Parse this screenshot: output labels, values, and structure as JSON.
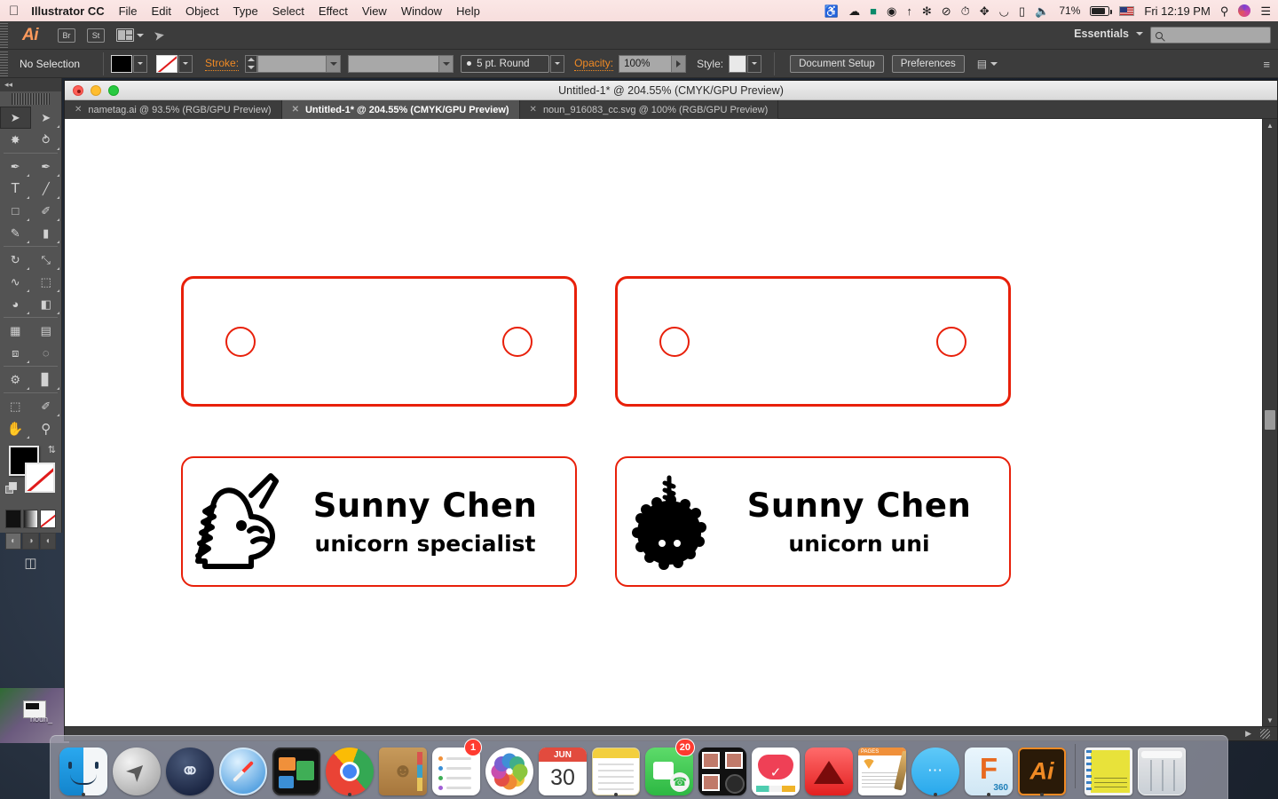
{
  "menubar": {
    "apple_icon": "apple-icon",
    "app_name": "Illustrator CC",
    "items": [
      "File",
      "Edit",
      "Object",
      "Type",
      "Select",
      "Effect",
      "View",
      "Window",
      "Help"
    ],
    "status_icons": [
      "airport-utility-icon",
      "creative-cloud-icon",
      "dropbox-icon",
      "mailbutler-icon",
      "fork-icon",
      "bug-icon",
      "do-not-disturb-icon",
      "time-machine-icon",
      "bluetooth-icon",
      "wifi-icon",
      "airplay-icon",
      "volume-icon"
    ],
    "battery_percent": "71%",
    "input_flag": "us-flag-icon",
    "clock": "Fri 12:19 PM",
    "spotlight_icon": "search-icon",
    "siri_icon": "siri-icon",
    "notification_icon": "notification-center-icon"
  },
  "app_bar": {
    "logo": "Ai",
    "bridge_label": "Br",
    "stock_label": "St",
    "arrange_icon": "arrange-documents-icon",
    "rocket_icon": "rocket-icon",
    "workspace": "Essentials",
    "search_placeholder": ""
  },
  "control_bar": {
    "selection_status": "No Selection",
    "fill_label": "fill-swatch",
    "stroke_swatch_label": "stroke-swatch",
    "stroke_label": "Stroke:",
    "stroke_weight": "",
    "stroke_variable_width": "",
    "brush_profile": "5 pt. Round",
    "opacity_label": "Opacity:",
    "opacity_value": "100%",
    "style_label": "Style:",
    "document_setup": "Document Setup",
    "preferences": "Preferences",
    "align_icon": "align-icon",
    "panel_menu_icon": "panel-menu-icon"
  },
  "tools": {
    "collapse_icon": "collapse-panel-icon",
    "items": [
      {
        "name": "selection-tool",
        "glyph": "➤",
        "selected": true
      },
      {
        "name": "direct-selection-tool",
        "glyph": "➤",
        "selected": false
      },
      {
        "name": "magic-wand-tool",
        "glyph": "✸",
        "selected": false
      },
      {
        "name": "lasso-tool",
        "glyph": "⤵",
        "selected": false
      },
      {
        "name": "pen-tool",
        "glyph": "✒",
        "selected": false
      },
      {
        "name": "curvature-tool",
        "glyph": "✒",
        "selected": false
      },
      {
        "name": "type-tool",
        "glyph": "T",
        "selected": false
      },
      {
        "name": "line-segment-tool",
        "glyph": "╱",
        "selected": false
      },
      {
        "name": "rectangle-tool",
        "glyph": "■",
        "selected": false
      },
      {
        "name": "paintbrush-tool",
        "glyph": "✎",
        "selected": false
      },
      {
        "name": "pencil-tool",
        "glyph": "✏",
        "selected": false
      },
      {
        "name": "eraser-tool",
        "glyph": "▰",
        "selected": false
      },
      {
        "name": "rotate-tool",
        "glyph": "↺",
        "selected": false
      },
      {
        "name": "scale-tool",
        "glyph": "⤡",
        "selected": false
      },
      {
        "name": "width-tool",
        "glyph": "∿",
        "selected": false
      },
      {
        "name": "free-transform-tool",
        "glyph": "⬚",
        "selected": false
      },
      {
        "name": "shape-builder-tool",
        "glyph": "◔",
        "selected": false
      },
      {
        "name": "perspective-grid-tool",
        "glyph": "◧",
        "selected": false
      },
      {
        "name": "mesh-tool",
        "glyph": "⁂",
        "selected": false
      },
      {
        "name": "gradient-tool",
        "glyph": "▤",
        "selected": false
      },
      {
        "name": "eyedropper-tool",
        "glyph": "⚗",
        "selected": false
      },
      {
        "name": "blend-tool",
        "glyph": "◎",
        "selected": false
      },
      {
        "name": "symbol-sprayer-tool",
        "glyph": "♨",
        "selected": false
      },
      {
        "name": "column-graph-tool",
        "glyph": "▫",
        "selected": false
      },
      {
        "name": "artboard-tool",
        "glyph": "⬚",
        "selected": false
      },
      {
        "name": "slice-tool",
        "glyph": "✂",
        "selected": false
      },
      {
        "name": "hand-tool",
        "glyph": "✋",
        "selected": false
      },
      {
        "name": "zoom-tool",
        "glyph": "⌕",
        "selected": false
      }
    ],
    "fill_color": "#000000",
    "stroke_color": "#ffffff",
    "swap_icon": "swap-fill-stroke-icon",
    "default_icon": "default-fill-stroke-icon",
    "color_modes": [
      "color-mode",
      "gradient-mode",
      "none-mode"
    ],
    "draw_modes": [
      "draw-normal",
      "draw-behind",
      "draw-inside"
    ],
    "screen_mode_icon": "change-screen-mode-icon"
  },
  "document_window": {
    "title": "Untitled-1* @ 204.55% (CMYK/GPU Preview)",
    "traffic_lights": [
      "close-button",
      "minimize-button",
      "zoom-button"
    ],
    "tabs": [
      {
        "label": "nametag.ai @ 93.5% (RGB/GPU Preview)",
        "active": false
      },
      {
        "label": "Untitled-1* @ 204.55% (CMYK/GPU Preview)",
        "active": true
      },
      {
        "label": "noun_916083_cc.svg @ 100% (RGB/GPU Preview)",
        "active": false
      }
    ]
  },
  "artwork": {
    "accent_color": "#e8200a",
    "nametags": [
      {
        "name": "nametag-blank-left",
        "has_art": false,
        "holes": 2
      },
      {
        "name": "nametag-blank-right",
        "has_art": false,
        "holes": 2
      },
      {
        "name": "nametag-unicorn-left",
        "has_art": true,
        "art": "unicorn-head-icon",
        "title": "Sunny Chen",
        "subtitle": "unicorn specialist"
      },
      {
        "name": "nametag-fuzzball-right",
        "has_art": true,
        "art": "fuzzy-unicorn-icon",
        "title": "Sunny Chen",
        "subtitle": "unicorn uni"
      }
    ]
  },
  "dock": {
    "items": [
      {
        "name": "finder",
        "running": true,
        "badge": null
      },
      {
        "name": "launchpad",
        "running": false,
        "badge": null
      },
      {
        "name": "steam",
        "running": false,
        "badge": null
      },
      {
        "name": "safari",
        "running": false,
        "badge": null
      },
      {
        "name": "mission-control",
        "running": false,
        "badge": null
      },
      {
        "name": "google-chrome",
        "running": true,
        "badge": null
      },
      {
        "name": "contacts",
        "running": false,
        "badge": null
      },
      {
        "name": "reminders",
        "running": false,
        "badge": "1"
      },
      {
        "name": "photos",
        "running": false,
        "badge": null
      },
      {
        "name": "calendar",
        "running": false,
        "badge": null,
        "month": "JUN",
        "day": "30"
      },
      {
        "name": "notes",
        "running": true,
        "badge": null
      },
      {
        "name": "facetime",
        "running": false,
        "badge": "20"
      },
      {
        "name": "photo-booth",
        "running": false,
        "badge": null
      },
      {
        "name": "pocket",
        "running": false,
        "badge": null
      },
      {
        "name": "autocad",
        "running": false,
        "badge": null
      },
      {
        "name": "pages",
        "running": false,
        "badge": null
      },
      {
        "name": "messages",
        "running": true,
        "badge": null
      },
      {
        "name": "fusion-360",
        "running": true,
        "badge": null,
        "label": "360"
      },
      {
        "name": "adobe-illustrator",
        "running": true,
        "badge": null,
        "label": "Ai"
      },
      {
        "name": "document-file",
        "running": false,
        "badge": null
      },
      {
        "name": "trash",
        "running": false,
        "badge": null
      }
    ]
  },
  "desktop": {
    "file_label": "noun_"
  }
}
